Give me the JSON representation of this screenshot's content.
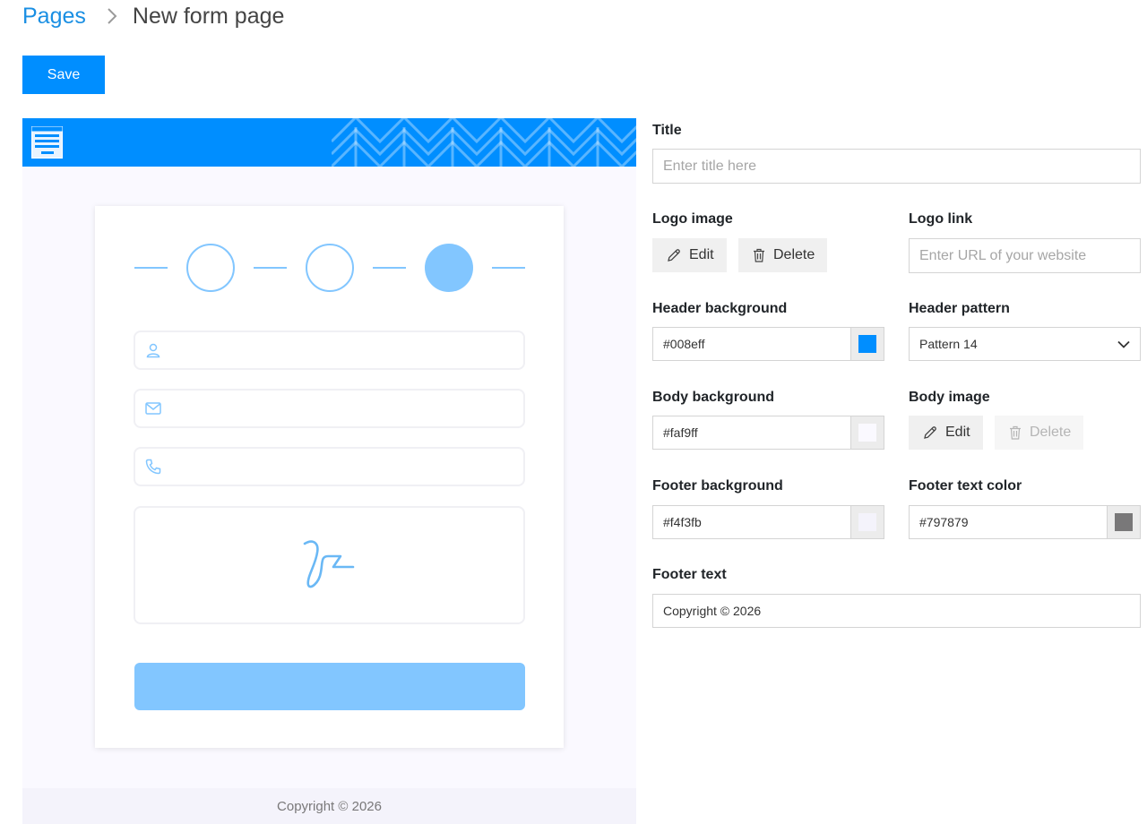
{
  "breadcrumb": {
    "parent": "Pages",
    "current": "New form page"
  },
  "toolbar": {
    "save_label": "Save"
  },
  "preview": {
    "footer_text": "Copyright © 2026",
    "colors": {
      "header": "#008eff",
      "body": "#faf9ff",
      "footer": "#f4f3fb",
      "accent": "#82c6ff"
    },
    "steps": {
      "count": 3,
      "active": 3
    }
  },
  "settings": {
    "title": {
      "label": "Title",
      "value": "",
      "placeholder": "Enter title here"
    },
    "logo_image": {
      "label": "Logo image",
      "edit_label": "Edit",
      "delete_label": "Delete"
    },
    "logo_link": {
      "label": "Logo link",
      "value": "",
      "placeholder": "Enter URL of your website"
    },
    "header_background": {
      "label": "Header background",
      "value": "#008eff",
      "swatch": "#008eff"
    },
    "header_pattern": {
      "label": "Header pattern",
      "selected": "Pattern 14"
    },
    "body_background": {
      "label": "Body background",
      "value": "#faf9ff",
      "swatch": "#faf9ff"
    },
    "body_image": {
      "label": "Body image",
      "edit_label": "Edit",
      "delete_label": "Delete",
      "delete_disabled": true
    },
    "footer_background": {
      "label": "Footer background",
      "value": "#f4f3fb",
      "swatch": "#f4f3fb"
    },
    "footer_text_color": {
      "label": "Footer text color",
      "value": "#797879",
      "swatch": "#797879"
    },
    "footer_text": {
      "label": "Footer text",
      "value": "Copyright © 2026"
    }
  },
  "icons": {
    "breadcrumb_separator": "chevron-right-icon",
    "logo": "form-logo-icon",
    "fields": [
      "user-icon",
      "mail-icon",
      "phone-icon",
      "signature-icon"
    ],
    "edit": "pencil-icon",
    "delete": "trash-icon",
    "select": "chevron-down-icon"
  }
}
